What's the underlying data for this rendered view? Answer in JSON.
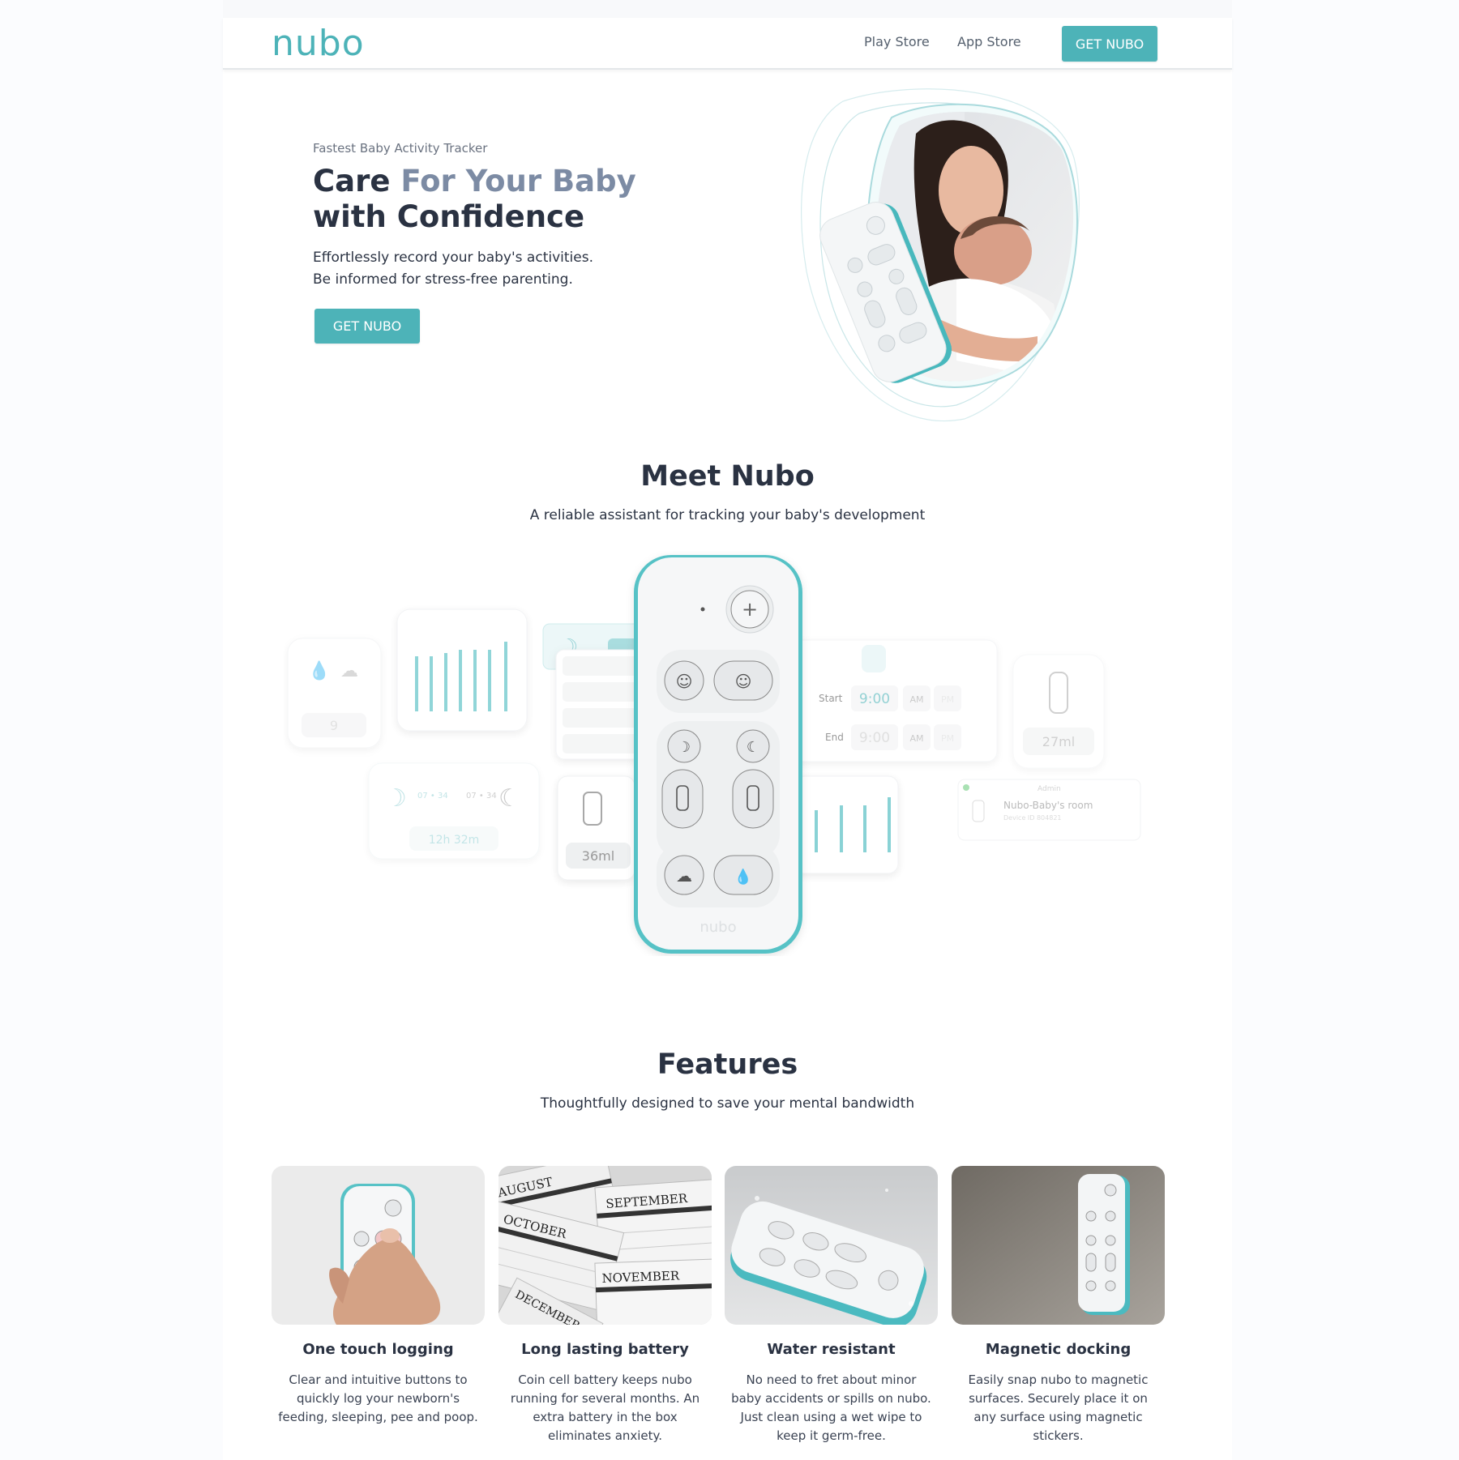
{
  "header": {
    "logo": "nubo",
    "nav": [
      {
        "label": "Play Store"
      },
      {
        "label": "App Store"
      }
    ],
    "cta": "GET NUBO"
  },
  "hero": {
    "eyebrow": "Fastest Baby Activity Tracker",
    "title_part1": "Care ",
    "title_accent": "For Your Baby",
    "title_part2": "with Confidence",
    "desc_line1": "Effortlessly record your baby's activities.",
    "desc_line2": "Be informed for stress-free parenting.",
    "cta": "GET NUBO"
  },
  "meet": {
    "title": "Meet Nubo",
    "subtitle": "A reliable assistant for tracking your baby's development",
    "cards": {
      "count": "9",
      "duration": "12h 32m",
      "pump_volume": "36ml",
      "bottle_volume": "27ml",
      "start_label": "Start",
      "end_label": "End",
      "time": "9:00",
      "am": "AM",
      "pm": "PM",
      "device_name": "Nubo-Baby's room",
      "device_role": "Admin",
      "device_id": "Device ID 804821",
      "sleep_start": "07 • 34",
      "sleep_end": "07 • 34"
    },
    "device_logo": "nubo"
  },
  "features": {
    "title": "Features",
    "subtitle": "Thoughtfully designed to save your mental bandwidth",
    "items": [
      {
        "title": "One touch logging",
        "desc": "Clear and intuitive buttons to quickly log your newborn's feeding, sleeping, pee and poop."
      },
      {
        "title": "Long lasting battery",
        "desc": "Coin cell battery keeps nubo running for several months. An extra battery in the box eliminates anxiety.",
        "calendar_months": [
          "AUGUST",
          "SEPTEMBER",
          "OCTOBER",
          "NOVEMBER",
          "DECEMBER"
        ]
      },
      {
        "title": "Water resistant",
        "desc": "No need to fret about minor baby accidents or spills on nubo. Just clean using a wet wipe to keep it germ-free."
      },
      {
        "title": "Magnetic docking",
        "desc": "Easily snap nubo to magnetic surfaces. Securely place it on any surface using magnetic stickers."
      }
    ]
  },
  "colors": {
    "brand": "#4db3b8",
    "heading": "#2a3242",
    "accent_text": "#7c8ba4"
  }
}
